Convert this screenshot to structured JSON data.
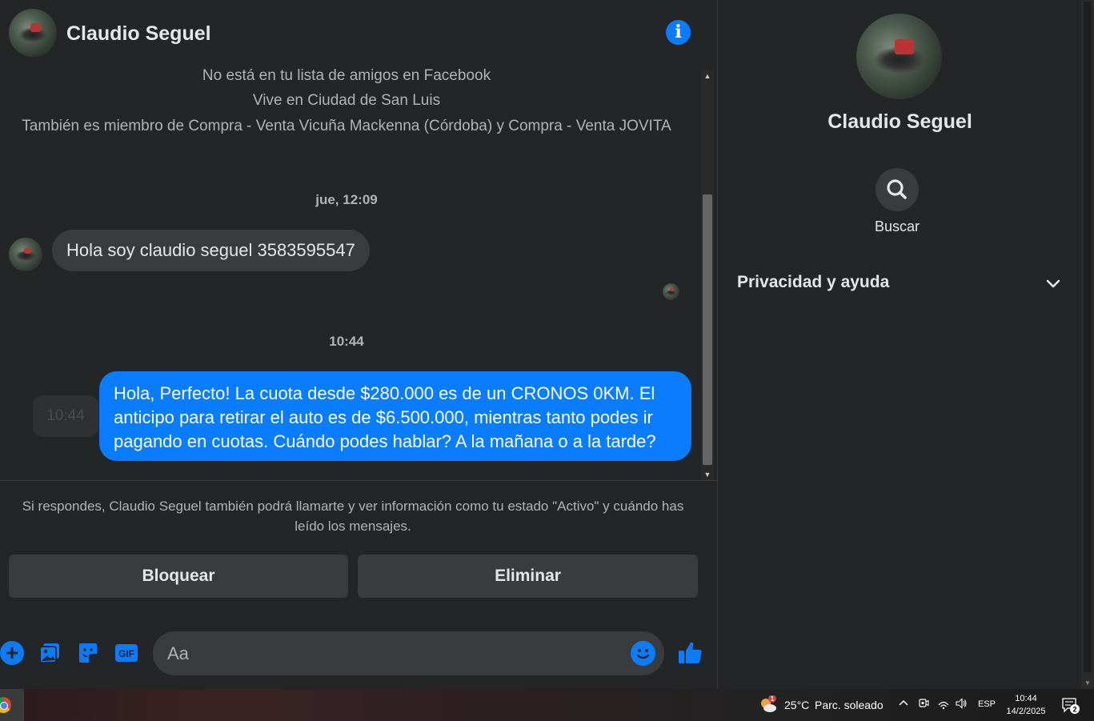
{
  "contact": {
    "name": "Claudio Seguel"
  },
  "header": {
    "info_label": "i"
  },
  "profile_meta": [
    "No está en tu lista de amigos en Facebook",
    "Vive en Ciudad de San Luis",
    "También es miembro de Compra - Venta Vicuña Mackenna (Córdoba) y Compra - Venta JOVITA"
  ],
  "messages": {
    "ts1": "jue, 12:09",
    "incoming": "Hola soy claudio seguel 3583595547",
    "ts2": "10:44",
    "outgoing": "Hola, Perfecto! La cuota desde $280.000 es de un CRONOS 0KM. El anticipo para retirar el auto es de $6.500.000, mientras tanto podes ir pagando en cuotas. Cuándo podes hablar? A la mañana o a la tarde?",
    "hover_time": "10:44"
  },
  "notice": "Si respondes, Claudio Seguel también podrá llamarte y ver información como tu estado \"Activo\" y cuándo has leído los mensajes.",
  "actions": {
    "block": "Bloquear",
    "delete": "Eliminar"
  },
  "composer": {
    "placeholder": "Aa",
    "gif_label": "GIF"
  },
  "sidebar": {
    "search_label": "Buscar",
    "privacy_label": "Privacidad y ayuda"
  },
  "taskbar": {
    "weather_badge": "1",
    "temperature": "25°C",
    "condition": "Parc. soleado",
    "language": "ESP",
    "time": "10:44",
    "date": "14/2/2025",
    "notification_count": "2"
  },
  "colors": {
    "accent": "#0a7cff",
    "background": "#242526",
    "bubble_in": "#3a3b3c"
  }
}
